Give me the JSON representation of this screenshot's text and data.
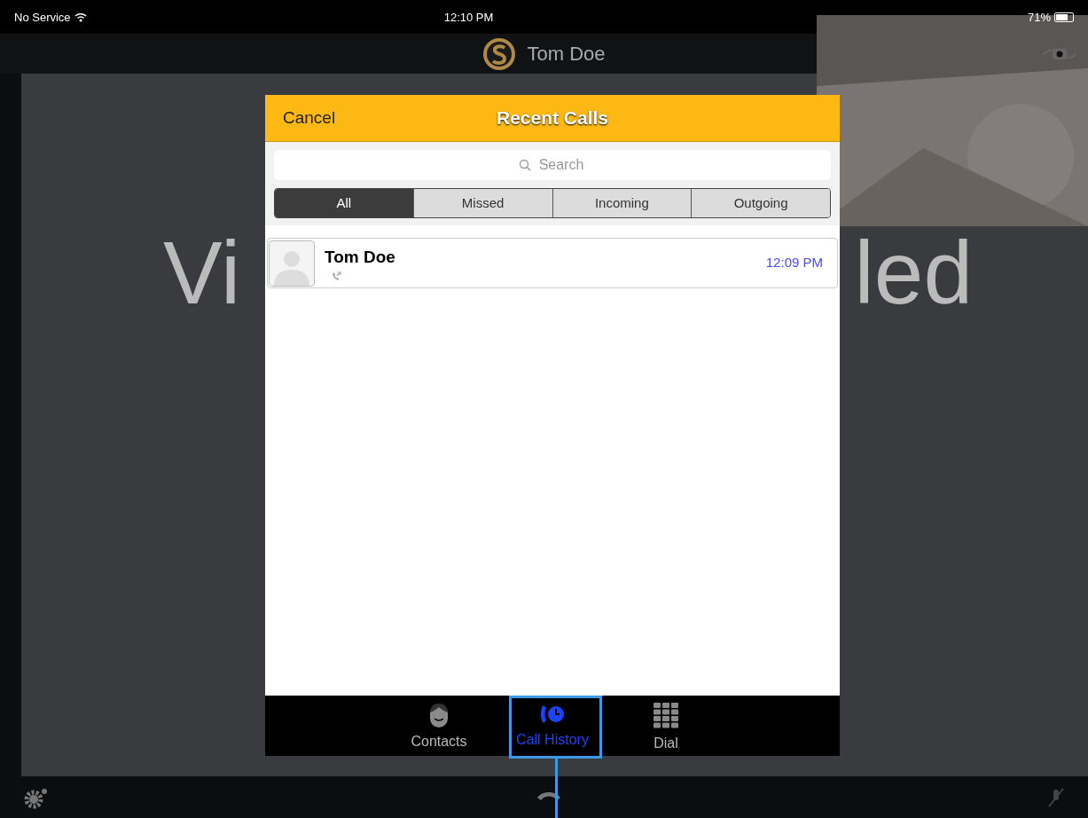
{
  "status_bar": {
    "carrier": "No Service",
    "time": "12:10 PM",
    "battery": "71%"
  },
  "nav_bar": {
    "title": "Tom Doe"
  },
  "background": {
    "text_left": "Vi",
    "text_right": "led"
  },
  "modal": {
    "cancel": "Cancel",
    "title": "Recent Calls",
    "search": {
      "placeholder": "Search"
    },
    "filters": [
      {
        "label": "All",
        "selected": true
      },
      {
        "label": "Missed",
        "selected": false
      },
      {
        "label": "Incoming",
        "selected": false
      },
      {
        "label": "Outgoing",
        "selected": false
      }
    ],
    "calls": [
      {
        "name": "Tom Doe",
        "time": "12:09 PM"
      }
    ],
    "tabs": [
      {
        "label": "Contacts",
        "kind": "contacts",
        "selected": false
      },
      {
        "label": "Call History",
        "kind": "history",
        "selected": true
      },
      {
        "label": "Dial",
        "kind": "dial",
        "selected": false
      }
    ]
  }
}
